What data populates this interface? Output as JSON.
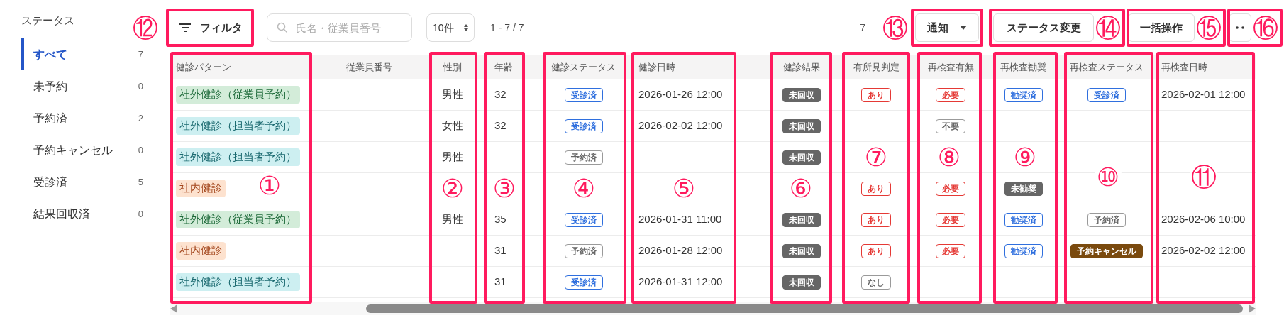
{
  "sidebar": {
    "title": "ステータス",
    "items": [
      {
        "label": "すべて",
        "count": "7",
        "selected": true
      },
      {
        "label": "未予約",
        "count": "0",
        "selected": false
      },
      {
        "label": "予約済",
        "count": "2",
        "selected": false
      },
      {
        "label": "予約キャンセル",
        "count": "0",
        "selected": false
      },
      {
        "label": "受診済",
        "count": "5",
        "selected": false
      },
      {
        "label": "結果回収済",
        "count": "0",
        "selected": false
      }
    ]
  },
  "toolbar": {
    "filter_button": "フィルタ",
    "search": {
      "placeholder": "氏名・従業員番号"
    },
    "page_size": "10件",
    "range": "1 - 7 / 7",
    "total": "7",
    "notify_button": "通知",
    "status_button": "ステータス変更",
    "bulk_button": "一括操作"
  },
  "table": {
    "columns": [
      "健診パターン",
      "従業員番号",
      "性別",
      "年齢",
      "健診ステータス",
      "健診日時",
      "健診結果",
      "有所見判定",
      "再検査有無",
      "再検査勧奨",
      "再検査ステータス",
      "再検査日時"
    ],
    "rows": [
      {
        "pattern": {
          "text": "社外健診（従業員予約）",
          "kind": "employee"
        },
        "gender": "男性",
        "age": "32",
        "status": {
          "text": "受診済",
          "kind": "blue"
        },
        "date": "2026-01-26 12:00",
        "result": {
          "text": "未回収",
          "kind": "dark"
        },
        "finding": {
          "text": "あり",
          "kind": "red"
        },
        "retest": {
          "text": "必要",
          "kind": "red"
        },
        "recommend": {
          "text": "勧奨済",
          "kind": "blue"
        },
        "retest_status": {
          "text": "受診済",
          "kind": "blue"
        },
        "retest_date": "2026-02-01 12:00"
      },
      {
        "pattern": {
          "text": "社外健診（担当者予約）",
          "kind": "staff"
        },
        "gender": "女性",
        "age": "32",
        "status": {
          "text": "受診済",
          "kind": "blue"
        },
        "date": "2026-02-02 12:00",
        "result": {
          "text": "未回収",
          "kind": "dark"
        },
        "retest": {
          "text": "不要",
          "kind": "gray"
        }
      },
      {
        "pattern": {
          "text": "社外健診（担当者予約）",
          "kind": "staff"
        },
        "gender": "男性",
        "status": {
          "text": "予約済",
          "kind": "gray"
        },
        "result": {
          "text": "未回収",
          "kind": "dark"
        }
      },
      {
        "pattern": {
          "text": "社内健診",
          "kind": "internal"
        },
        "finding": {
          "text": "あり",
          "kind": "red"
        },
        "retest": {
          "text": "必要",
          "kind": "red"
        },
        "recommend": {
          "text": "未勧奨",
          "kind": "dark"
        }
      },
      {
        "pattern": {
          "text": "社外健診（従業員予約）",
          "kind": "employee"
        },
        "gender": "男性",
        "age": "35",
        "status": {
          "text": "受診済",
          "kind": "blue"
        },
        "date": "2026-01-31 11:00",
        "result": {
          "text": "未回収",
          "kind": "dark"
        },
        "finding": {
          "text": "あり",
          "kind": "red"
        },
        "retest": {
          "text": "必要",
          "kind": "red"
        },
        "recommend": {
          "text": "勧奨済",
          "kind": "blue"
        },
        "retest_status": {
          "text": "予約済",
          "kind": "gray"
        },
        "retest_date": "2026-02-06 10:00"
      },
      {
        "pattern": {
          "text": "社内健診",
          "kind": "internal"
        },
        "age": "31",
        "status": {
          "text": "予約済",
          "kind": "gray"
        },
        "date": "2026-01-28 12:00",
        "result": {
          "text": "未回収",
          "kind": "dark"
        },
        "finding": {
          "text": "あり",
          "kind": "red"
        },
        "retest": {
          "text": "必要",
          "kind": "red"
        },
        "recommend": {
          "text": "勧奨済",
          "kind": "blue"
        },
        "retest_status": {
          "text": "予約キャンセル",
          "kind": "brown"
        },
        "retest_date": "2026-02-02 12:00"
      },
      {
        "pattern": {
          "text": "社外健診（担当者予約）",
          "kind": "staff"
        },
        "age": "31",
        "status": {
          "text": "受診済",
          "kind": "blue"
        },
        "date": "2026-01-31 12:00",
        "result": {
          "text": "未回収",
          "kind": "dark"
        },
        "finding": {
          "text": "なし",
          "kind": "gray"
        }
      }
    ]
  },
  "annotations": [
    {
      "label": "⑫"
    },
    {
      "label": "⑬"
    },
    {
      "label": "⑭"
    },
    {
      "label": "⑮"
    },
    {
      "label": "⑯"
    },
    {
      "label": "①"
    },
    {
      "label": "②"
    },
    {
      "label": "③"
    },
    {
      "label": "④"
    },
    {
      "label": "⑤"
    },
    {
      "label": "⑥"
    },
    {
      "label": "⑦"
    },
    {
      "label": "⑧"
    },
    {
      "label": "⑨"
    },
    {
      "label": "⑩"
    },
    {
      "label": "⑪"
    }
  ]
}
